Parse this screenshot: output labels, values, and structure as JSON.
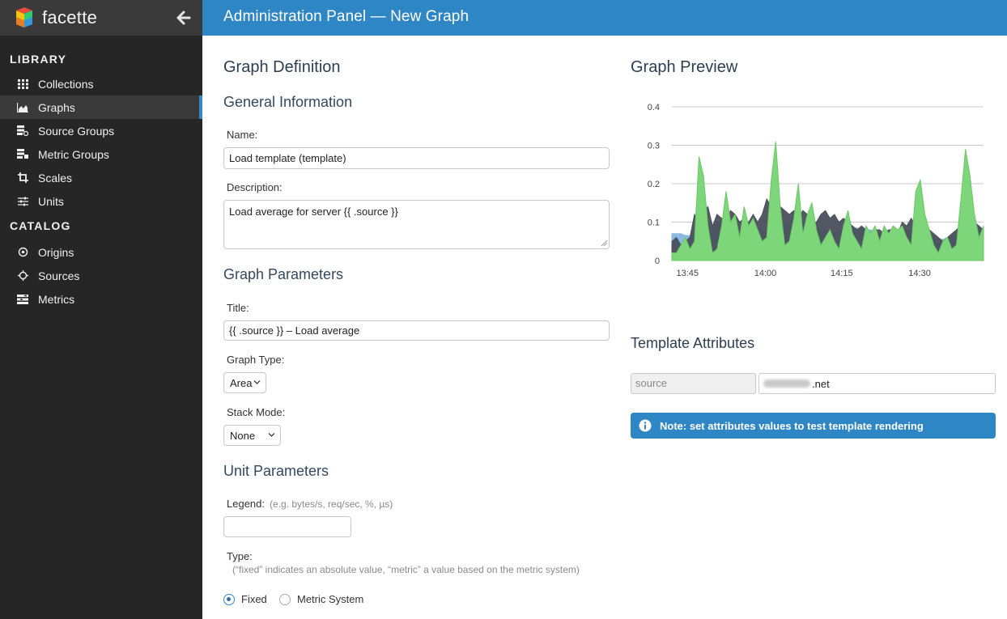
{
  "brand": {
    "name": "facette"
  },
  "sidebar": {
    "library_title": "LIBRARY",
    "library_items": [
      {
        "label": "Collections",
        "icon": "grid-icon"
      },
      {
        "label": "Graphs",
        "icon": "area-chart-icon",
        "active": true
      },
      {
        "label": "Source Groups",
        "icon": "source-groups-icon"
      },
      {
        "label": "Metric Groups",
        "icon": "metric-groups-icon"
      },
      {
        "label": "Scales",
        "icon": "crop-icon"
      },
      {
        "label": "Units",
        "icon": "sliders-icon"
      }
    ],
    "catalog_title": "CATALOG",
    "catalog_items": [
      {
        "label": "Origins",
        "icon": "target-icon"
      },
      {
        "label": "Sources",
        "icon": "crosshair-icon"
      },
      {
        "label": "Metrics",
        "icon": "list-icon"
      }
    ]
  },
  "header": {
    "title": "Administration Panel — New Graph"
  },
  "form": {
    "heading": "Graph Definition",
    "general_heading": "General Information",
    "name_label": "Name:",
    "name_value": "Load template (template)",
    "description_label": "Description:",
    "description_value": "Load average for server {{ .source }}",
    "params_heading": "Graph Parameters",
    "title_label": "Title:",
    "title_value": "{{ .source }} – Load average",
    "graph_type_label": "Graph Type:",
    "graph_type_value": "Area",
    "stack_mode_label": "Stack Mode:",
    "stack_mode_value": "None",
    "unit_heading": "Unit Parameters",
    "legend_label": "Legend:",
    "legend_hint": "(e.g. bytes/s, req/sec, %, µs)",
    "legend_value": "",
    "type_label": "Type:",
    "type_hint": "(“fixed” indicates an absolute value, “metric” a value based on the metric system)",
    "type_options": [
      {
        "label": "Fixed",
        "checked": true
      },
      {
        "label": "Metric System",
        "checked": false
      }
    ]
  },
  "preview": {
    "heading": "Graph Preview"
  },
  "template_attributes": {
    "heading": "Template Attributes",
    "key": "source",
    "value_suffix": ".net",
    "note": "Note: set attributes values to test template rendering"
  },
  "colors": {
    "header": "#2f86c5",
    "sidebar": "#262626",
    "series_green": "#7ed67a",
    "series_dark": "#4a4f5c",
    "series_blue": "#8ab8df"
  },
  "chart_data": {
    "type": "area",
    "x_ticks": [
      "13:45",
      "14:00",
      "14:15",
      "14:30"
    ],
    "y_ticks": [
      "0",
      "0.1",
      "0.2",
      "0.3",
      "0.4"
    ],
    "ylim": [
      0,
      0.4
    ],
    "grid": true,
    "series": [
      {
        "values": [
          0.07,
          0.07,
          0.07,
          0.065,
          0.065,
          0.07,
          0.07,
          0.075,
          0.08,
          0.09,
          0.1,
          0.1,
          0.095,
          0.09,
          0.09,
          0.085,
          0.085,
          0.09,
          0.09,
          0.085,
          0.08,
          0.075,
          0.075,
          0.08,
          0.085,
          0.09,
          0.1,
          0.11,
          0.11,
          0.1,
          0.095,
          0.09,
          0.085,
          0.08,
          0.08,
          0.075,
          0.075,
          0.075,
          0.08,
          0.08,
          0.085,
          0.085,
          0.08,
          0.08,
          0.08,
          0.075,
          0.07,
          0.07,
          0.07,
          0.075,
          0.075,
          0.08,
          0.08,
          0.075,
          0.07,
          0.065,
          0.06,
          0.06,
          0.055,
          0.055,
          0.055,
          0.06,
          0.06,
          0.065,
          0.07,
          0.075,
          0.08,
          0.08,
          0.08,
          0.075
        ]
      },
      {
        "values": [
          0.05,
          0.06,
          0.04,
          0.05,
          0.06,
          0.12,
          0.1,
          0.13,
          0.14,
          0.09,
          0.12,
          0.11,
          0.1,
          0.13,
          0.12,
          0.1,
          0.11,
          0.1,
          0.12,
          0.1,
          0.12,
          0.16,
          0.14,
          0.12,
          0.14,
          0.13,
          0.12,
          0.13,
          0.11,
          0.13,
          0.12,
          0.1,
          0.1,
          0.12,
          0.13,
          0.11,
          0.12,
          0.1,
          0.11,
          0.1,
          0.09,
          0.08,
          0.09,
          0.08,
          0.07,
          0.08,
          0.08,
          0.07,
          0.08,
          0.08,
          0.07,
          0.1,
          0.09,
          0.11,
          0.09,
          0.08,
          0.1,
          0.08,
          0.07,
          0.06,
          0.05,
          0.06,
          0.07,
          0.08,
          0.09,
          0.11,
          0.11,
          0.1,
          0.09,
          0.08
        ]
      },
      {
        "values": [
          0.02,
          0.02,
          0.04,
          0.06,
          0.03,
          0.05,
          0.27,
          0.22,
          0.09,
          0.02,
          0.03,
          0.09,
          0.18,
          0.1,
          0.12,
          0.06,
          0.14,
          0.09,
          0.11,
          0.08,
          0.05,
          0.06,
          0.21,
          0.31,
          0.14,
          0.04,
          0.05,
          0.11,
          0.2,
          0.07,
          0.12,
          0.15,
          0.08,
          0.04,
          0.06,
          0.08,
          0.05,
          0.03,
          0.09,
          0.13,
          0.07,
          0.05,
          0.03,
          0.09,
          0.07,
          0.09,
          0.05,
          0.09,
          0.07,
          0.09,
          0.08,
          0.09,
          0.06,
          0.04,
          0.18,
          0.21,
          0.12,
          0.08,
          0.04,
          0.02,
          0.05,
          0.06,
          0.03,
          0.04,
          0.16,
          0.29,
          0.22,
          0.12,
          0.06,
          0.09
        ]
      }
    ]
  }
}
